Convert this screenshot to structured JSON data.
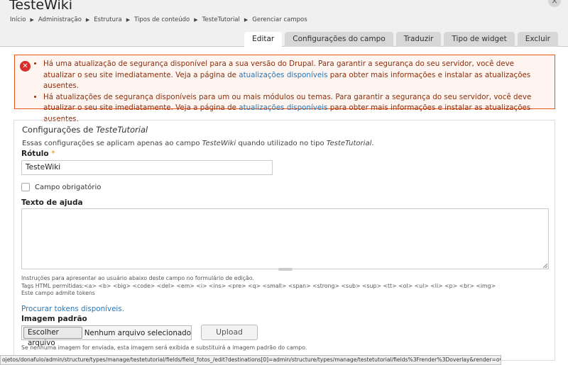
{
  "header": {
    "site_title": "TesteWiki",
    "close_label": "×",
    "breadcrumb": [
      "Início",
      "Administração",
      "Estrutura",
      "Tipos de conteúdo",
      "TesteTutorial",
      "Gerenciar campos"
    ],
    "breadcrumb_separator": "▶"
  },
  "tabs": [
    {
      "label": "Editar",
      "active": true
    },
    {
      "label": "Configurações do campo",
      "active": false
    },
    {
      "label": "Traduzir",
      "active": false
    },
    {
      "label": "Tipo de widget",
      "active": false
    },
    {
      "label": "Excluir",
      "active": false
    }
  ],
  "messages": {
    "icon_glyph": "✕",
    "items": [
      {
        "text_before": "Há uma atualização de segurança disponível para a sua versão do Drupal. Para garantir a segurança do seu servidor, você deve atualizar o seu site imediatamente. Veja a página de ",
        "link": "atualizações disponíveis",
        "text_after": " para obter mais informações e instalar as atualizações ausentes."
      },
      {
        "text_before": "Há atualizações de segurança disponíveis para um ou mais módulos ou temas. Para garantir a segurança do seu servidor, você deve atualizar o seu site imediatamente. Veja a página de ",
        "link": "atualizações disponíveis",
        "text_after": " para obter mais informações e instalar as atualizações ausentes."
      }
    ]
  },
  "form": {
    "legend_prefix": "Configurações de ",
    "legend_type": "TesteTutorial",
    "description_parts": [
      "Essas configurações se aplicam apenas ao campo ",
      "TesteWiki",
      " quando utilizado no tipo ",
      "TesteTutorial",
      "."
    ],
    "rotulo_label": "Rótulo",
    "required_mark": "*",
    "rotulo_value": "TesteWiki",
    "required_checkbox_label": "Campo obrigatório",
    "help_text_label": "Texto de ajuda",
    "help_text_value": "",
    "help_description_1": "Instruções para apresentar ao usuário abaixo deste campo no formulário de edição.",
    "help_description_2": "Tags HTML permitidas:<a> <b> <big> <code> <del> <em> <i> <ins> <pre> <q> <small> <span> <strong> <sub> <sup> <tt> <ol> <ul> <li> <p> <br> <img>",
    "help_description_3": "Este campo admite tokens",
    "tokens_link": "Procurar tokens disponíveis.",
    "default_image_label": "Imagem padrão",
    "choose_file_button": "Escolher arquivo",
    "no_file_selected": "Nenhum arquivo selecionado",
    "upload_button": "Upload",
    "default_image_description": "Se nenhuma imagem for enviada, esta imagem será exibida e substituirá a imagem padrão do campo."
  },
  "statusbar": {
    "url": "ojetos/donafulo/admin/structure/types/manage/testetutorial/fields/field_fotos_/edit?destinations[0]=admin/structure/types/manage/testetutorial/fields%3Frender%3Doverlay&render=overlay#"
  },
  "colors": {
    "error_border": "#ed541d",
    "error_background": "#fef5f1",
    "error_text": "#8c2e0b",
    "link": "#2876b8",
    "required": "#e09010"
  }
}
